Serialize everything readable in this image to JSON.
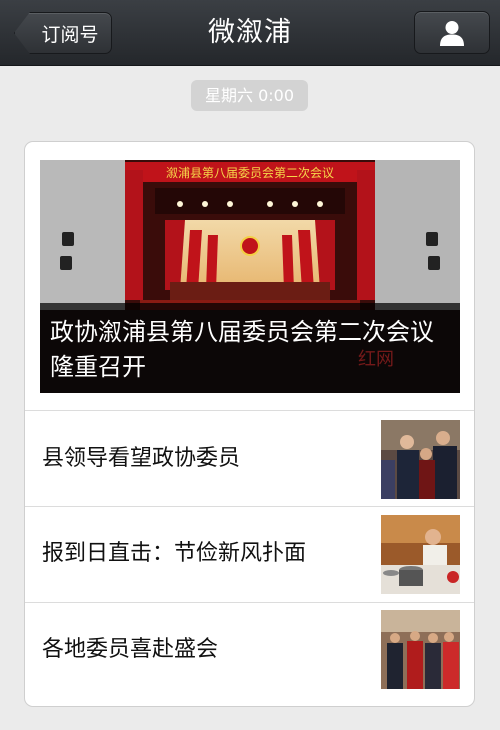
{
  "navbar": {
    "back_label": "订阅号",
    "title": "微溆浦",
    "profile_icon": "person-icon"
  },
  "timestamp": "星期六 0:00",
  "article": {
    "cover": {
      "title": "政协溆浦县第八届委员会第二次会议隆重召开",
      "banner_text": "溆浦县第八届委员会第二次会议",
      "watermark": "红网"
    },
    "items": [
      {
        "title": "县领导看望政协委员"
      },
      {
        "title": "报到日直击：节俭新风扑面"
      },
      {
        "title": "各地委员喜赴盛会"
      }
    ]
  },
  "colors": {
    "navbar": "#2d3035",
    "background": "#ebebeb",
    "stage_red": "#b3121a"
  }
}
